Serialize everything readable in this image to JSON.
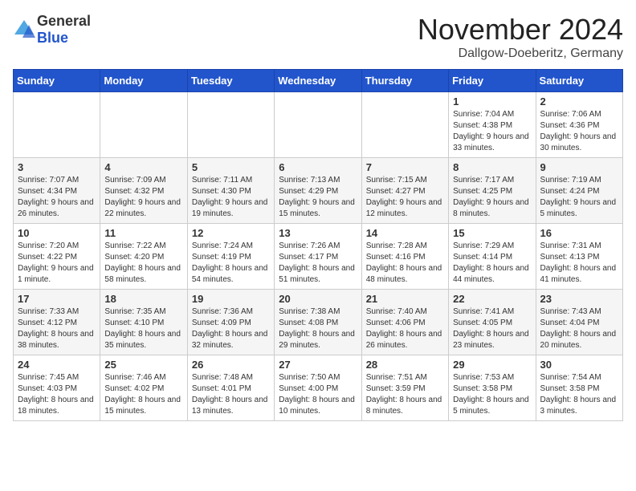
{
  "header": {
    "logo_general": "General",
    "logo_blue": "Blue",
    "month_year": "November 2024",
    "location": "Dallgow-Doeberitz, Germany"
  },
  "weekdays": [
    "Sunday",
    "Monday",
    "Tuesday",
    "Wednesday",
    "Thursday",
    "Friday",
    "Saturday"
  ],
  "weeks": [
    [
      {
        "day": "",
        "sunrise": "",
        "sunset": "",
        "daylight": ""
      },
      {
        "day": "",
        "sunrise": "",
        "sunset": "",
        "daylight": ""
      },
      {
        "day": "",
        "sunrise": "",
        "sunset": "",
        "daylight": ""
      },
      {
        "day": "",
        "sunrise": "",
        "sunset": "",
        "daylight": ""
      },
      {
        "day": "",
        "sunrise": "",
        "sunset": "",
        "daylight": ""
      },
      {
        "day": "1",
        "sunrise": "Sunrise: 7:04 AM",
        "sunset": "Sunset: 4:38 PM",
        "daylight": "Daylight: 9 hours and 33 minutes."
      },
      {
        "day": "2",
        "sunrise": "Sunrise: 7:06 AM",
        "sunset": "Sunset: 4:36 PM",
        "daylight": "Daylight: 9 hours and 30 minutes."
      }
    ],
    [
      {
        "day": "3",
        "sunrise": "Sunrise: 7:07 AM",
        "sunset": "Sunset: 4:34 PM",
        "daylight": "Daylight: 9 hours and 26 minutes."
      },
      {
        "day": "4",
        "sunrise": "Sunrise: 7:09 AM",
        "sunset": "Sunset: 4:32 PM",
        "daylight": "Daylight: 9 hours and 22 minutes."
      },
      {
        "day": "5",
        "sunrise": "Sunrise: 7:11 AM",
        "sunset": "Sunset: 4:30 PM",
        "daylight": "Daylight: 9 hours and 19 minutes."
      },
      {
        "day": "6",
        "sunrise": "Sunrise: 7:13 AM",
        "sunset": "Sunset: 4:29 PM",
        "daylight": "Daylight: 9 hours and 15 minutes."
      },
      {
        "day": "7",
        "sunrise": "Sunrise: 7:15 AM",
        "sunset": "Sunset: 4:27 PM",
        "daylight": "Daylight: 9 hours and 12 minutes."
      },
      {
        "day": "8",
        "sunrise": "Sunrise: 7:17 AM",
        "sunset": "Sunset: 4:25 PM",
        "daylight": "Daylight: 9 hours and 8 minutes."
      },
      {
        "day": "9",
        "sunrise": "Sunrise: 7:19 AM",
        "sunset": "Sunset: 4:24 PM",
        "daylight": "Daylight: 9 hours and 5 minutes."
      }
    ],
    [
      {
        "day": "10",
        "sunrise": "Sunrise: 7:20 AM",
        "sunset": "Sunset: 4:22 PM",
        "daylight": "Daylight: 9 hours and 1 minute."
      },
      {
        "day": "11",
        "sunrise": "Sunrise: 7:22 AM",
        "sunset": "Sunset: 4:20 PM",
        "daylight": "Daylight: 8 hours and 58 minutes."
      },
      {
        "day": "12",
        "sunrise": "Sunrise: 7:24 AM",
        "sunset": "Sunset: 4:19 PM",
        "daylight": "Daylight: 8 hours and 54 minutes."
      },
      {
        "day": "13",
        "sunrise": "Sunrise: 7:26 AM",
        "sunset": "Sunset: 4:17 PM",
        "daylight": "Daylight: 8 hours and 51 minutes."
      },
      {
        "day": "14",
        "sunrise": "Sunrise: 7:28 AM",
        "sunset": "Sunset: 4:16 PM",
        "daylight": "Daylight: 8 hours and 48 minutes."
      },
      {
        "day": "15",
        "sunrise": "Sunrise: 7:29 AM",
        "sunset": "Sunset: 4:14 PM",
        "daylight": "Daylight: 8 hours and 44 minutes."
      },
      {
        "day": "16",
        "sunrise": "Sunrise: 7:31 AM",
        "sunset": "Sunset: 4:13 PM",
        "daylight": "Daylight: 8 hours and 41 minutes."
      }
    ],
    [
      {
        "day": "17",
        "sunrise": "Sunrise: 7:33 AM",
        "sunset": "Sunset: 4:12 PM",
        "daylight": "Daylight: 8 hours and 38 minutes."
      },
      {
        "day": "18",
        "sunrise": "Sunrise: 7:35 AM",
        "sunset": "Sunset: 4:10 PM",
        "daylight": "Daylight: 8 hours and 35 minutes."
      },
      {
        "day": "19",
        "sunrise": "Sunrise: 7:36 AM",
        "sunset": "Sunset: 4:09 PM",
        "daylight": "Daylight: 8 hours and 32 minutes."
      },
      {
        "day": "20",
        "sunrise": "Sunrise: 7:38 AM",
        "sunset": "Sunset: 4:08 PM",
        "daylight": "Daylight: 8 hours and 29 minutes."
      },
      {
        "day": "21",
        "sunrise": "Sunrise: 7:40 AM",
        "sunset": "Sunset: 4:06 PM",
        "daylight": "Daylight: 8 hours and 26 minutes."
      },
      {
        "day": "22",
        "sunrise": "Sunrise: 7:41 AM",
        "sunset": "Sunset: 4:05 PM",
        "daylight": "Daylight: 8 hours and 23 minutes."
      },
      {
        "day": "23",
        "sunrise": "Sunrise: 7:43 AM",
        "sunset": "Sunset: 4:04 PM",
        "daylight": "Daylight: 8 hours and 20 minutes."
      }
    ],
    [
      {
        "day": "24",
        "sunrise": "Sunrise: 7:45 AM",
        "sunset": "Sunset: 4:03 PM",
        "daylight": "Daylight: 8 hours and 18 minutes."
      },
      {
        "day": "25",
        "sunrise": "Sunrise: 7:46 AM",
        "sunset": "Sunset: 4:02 PM",
        "daylight": "Daylight: 8 hours and 15 minutes."
      },
      {
        "day": "26",
        "sunrise": "Sunrise: 7:48 AM",
        "sunset": "Sunset: 4:01 PM",
        "daylight": "Daylight: 8 hours and 13 minutes."
      },
      {
        "day": "27",
        "sunrise": "Sunrise: 7:50 AM",
        "sunset": "Sunset: 4:00 PM",
        "daylight": "Daylight: 8 hours and 10 minutes."
      },
      {
        "day": "28",
        "sunrise": "Sunrise: 7:51 AM",
        "sunset": "Sunset: 3:59 PM",
        "daylight": "Daylight: 8 hours and 8 minutes."
      },
      {
        "day": "29",
        "sunrise": "Sunrise: 7:53 AM",
        "sunset": "Sunset: 3:58 PM",
        "daylight": "Daylight: 8 hours and 5 minutes."
      },
      {
        "day": "30",
        "sunrise": "Sunrise: 7:54 AM",
        "sunset": "Sunset: 3:58 PM",
        "daylight": "Daylight: 8 hours and 3 minutes."
      }
    ]
  ]
}
